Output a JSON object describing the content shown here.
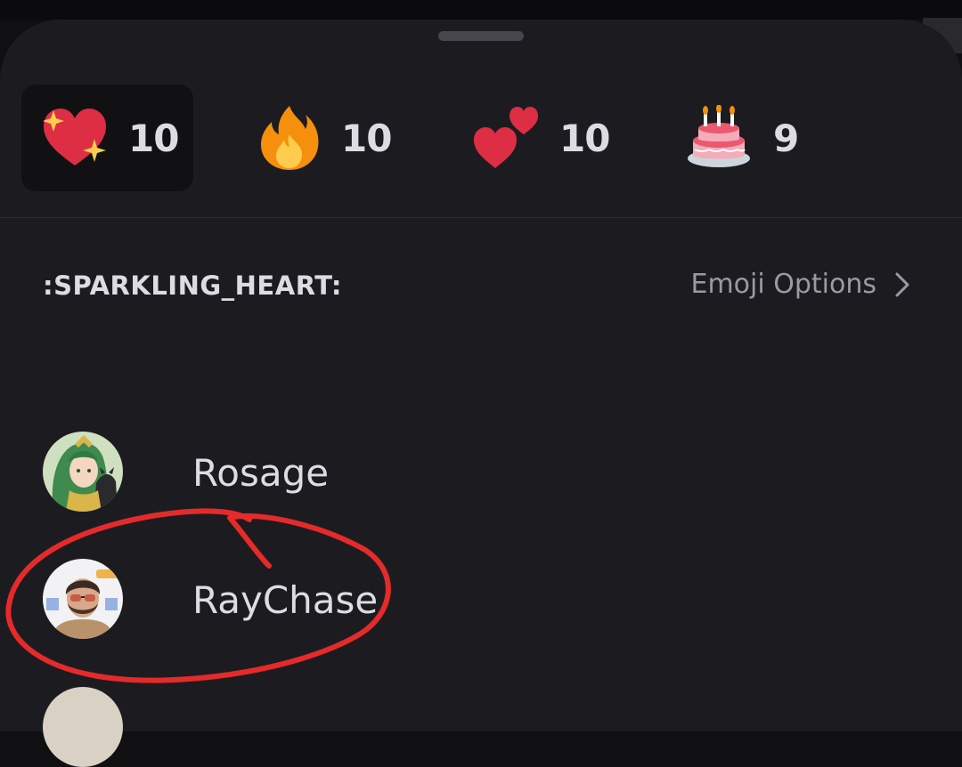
{
  "reactions": [
    {
      "emoji": "sparkling-heart-icon",
      "count": "10",
      "selected": true
    },
    {
      "emoji": "fire-icon",
      "count": "10",
      "selected": false
    },
    {
      "emoji": "two-hearts-icon",
      "count": "10",
      "selected": false
    },
    {
      "emoji": "birthday-cake-icon",
      "count": "9",
      "selected": false
    }
  ],
  "selected_emoji_name": ":SPARKLING_HEART:",
  "emoji_options_label": "Emoji Options",
  "users": [
    {
      "name": "Rosage",
      "avatar": "rosage-avatar"
    },
    {
      "name": "RayChase",
      "avatar": "raychase-avatar"
    }
  ],
  "colors": {
    "sheet_background": "#1c1c20",
    "selected_tab": "#111114",
    "text_primary": "#dcdde2",
    "text_secondary": "#9a9aa3",
    "annotation_red": "#e52a2a"
  }
}
